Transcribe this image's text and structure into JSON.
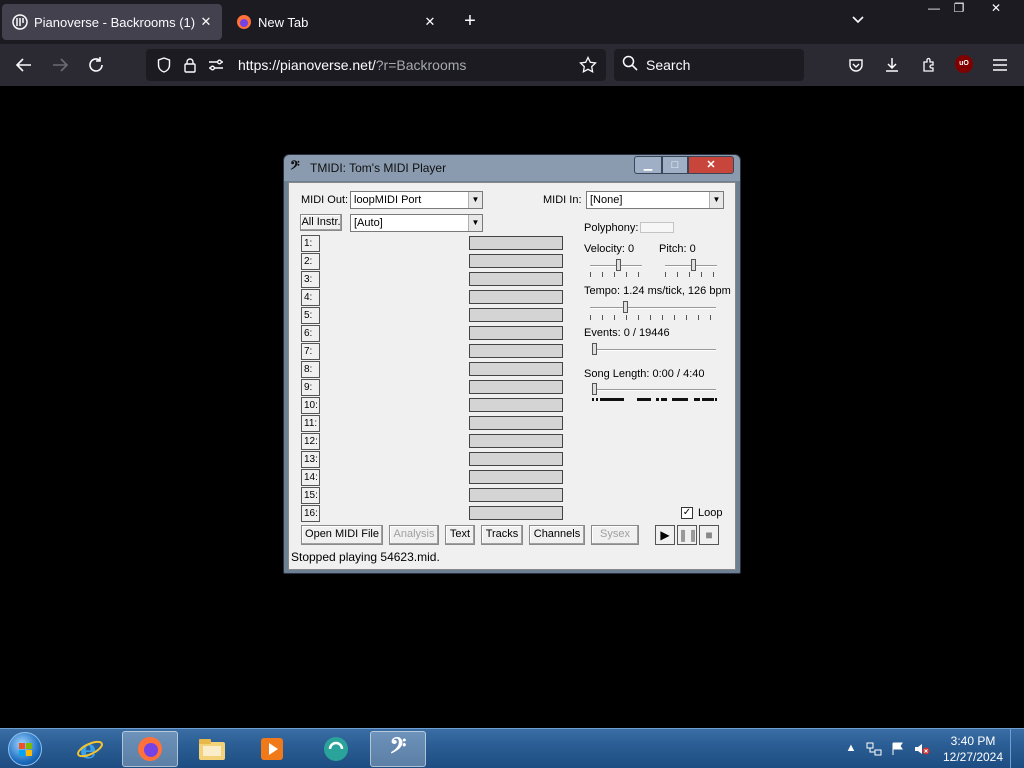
{
  "browser": {
    "tabs": [
      {
        "title": "Pianoverse - Backrooms (1)",
        "active": true
      },
      {
        "title": "New Tab",
        "active": false
      }
    ],
    "url_main": "https://pianoverse.net/",
    "url_rest": "?r=Backrooms",
    "search_placeholder": "Search",
    "window_controls": {
      "minimize": "—",
      "restore": "❐",
      "close": "✕"
    },
    "ublock_label": "uO"
  },
  "tmidi": {
    "title": "TMIDI: Tom's MIDI Player",
    "midi_out_label": "MIDI Out:",
    "midi_out_value": "loopMIDI Port",
    "midi_in_label": "MIDI In:",
    "midi_in_value": "[None]",
    "all_instr_label": "All Instr.",
    "instr_value": "[Auto]",
    "channels": [
      "1:",
      "2:",
      "3:",
      "4:",
      "5:",
      "6:",
      "7:",
      "8:",
      "9:",
      "10:",
      "11:",
      "12:",
      "13:",
      "14:",
      "15:",
      "16:"
    ],
    "polyphony_label": "Polyphony:",
    "velocity_label": "Velocity: 0",
    "pitch_label": "Pitch: 0",
    "tempo_label": "Tempo: 1.24 ms/tick, 126 bpm",
    "events_label": "Events: 0 / 19446",
    "song_length_label": "Song Length: 0:00 / 4:40",
    "loop_label": "Loop",
    "loop_checked": true,
    "buttons": {
      "open": "Open MIDI File",
      "analysis": "Analysis",
      "text": "Text",
      "tracks": "Tracks",
      "channels": "Channels",
      "sysex": "Sysex"
    },
    "status": "Stopped playing 54623.mid."
  },
  "taskbar": {
    "time": "3:40 PM",
    "date": "12/27/2024"
  }
}
